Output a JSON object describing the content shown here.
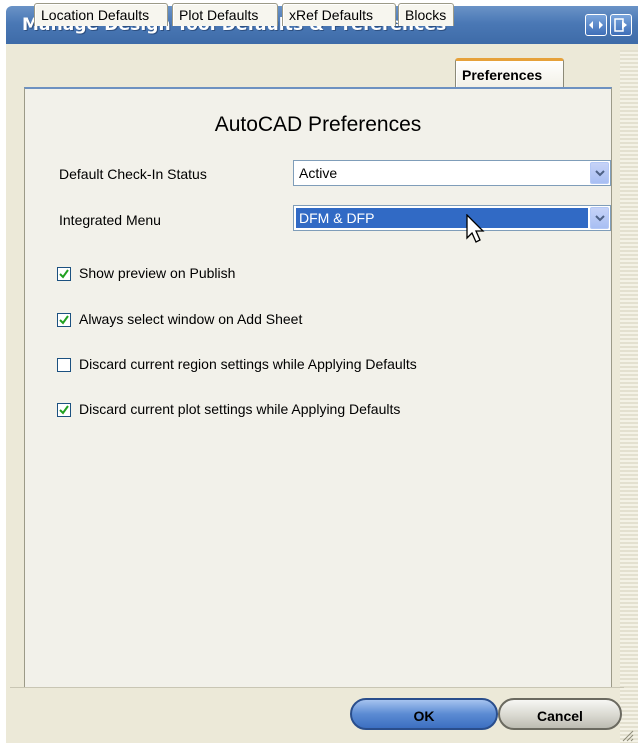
{
  "window": {
    "title": "Manage Design Tool Defaults & Preferences"
  },
  "tabs": [
    {
      "label": "Location Defaults",
      "active": false
    },
    {
      "label": "Plot Defaults",
      "active": false
    },
    {
      "label": "xRef Defaults",
      "active": false
    },
    {
      "label": "Blocks",
      "active": false
    },
    {
      "label": "Preferences",
      "active": true
    }
  ],
  "panel": {
    "title": "AutoCAD Preferences",
    "fields": [
      {
        "label": "Default Check-In Status",
        "value": "Active",
        "highlighted": false
      },
      {
        "label": "Integrated Menu",
        "value": "DFM & DFP",
        "highlighted": true
      }
    ],
    "checkboxes": [
      {
        "label": "Show preview on Publish",
        "checked": true
      },
      {
        "label": "Always select window on Add Sheet",
        "checked": true
      },
      {
        "label": "Discard current region settings while Applying Defaults",
        "checked": false
      },
      {
        "label": "Discard current plot settings while Applying Defaults",
        "checked": true
      }
    ]
  },
  "buttons": {
    "ok": "OK",
    "cancel": "Cancel"
  },
  "colors": {
    "titlebar": "#4a78b5",
    "selection": "#316ac5",
    "active_tab_accent": "#e6a13a"
  }
}
